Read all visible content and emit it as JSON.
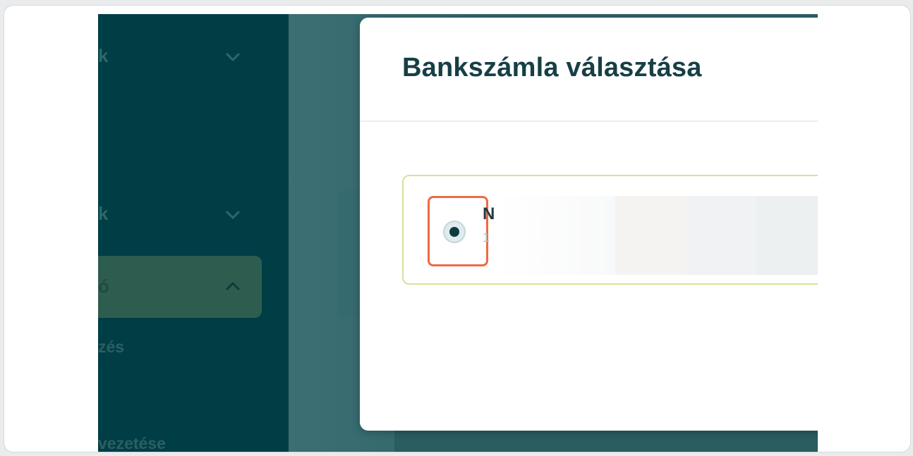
{
  "sidebar": {
    "items": [
      {
        "label": "k",
        "chevron": "chevron-down-icon"
      },
      {
        "label": "k",
        "chevron": "chevron-down-icon"
      },
      {
        "label": "ó",
        "chevron": "chevron-up-icon",
        "active": true
      }
    ],
    "subitems": [
      "zés",
      "vezetése"
    ]
  },
  "modal": {
    "title": "Bankszámla választása",
    "account": {
      "name_initial": "N",
      "number_initial": "1",
      "selected": true
    }
  },
  "colors": {
    "sidebar_bg": "#003e46",
    "active_item_bg": "#2d5d4e",
    "modal_title": "#173f45",
    "card_border": "#d5e39a",
    "highlight": "#ee6a43",
    "radio_dot": "#0e3a40"
  }
}
